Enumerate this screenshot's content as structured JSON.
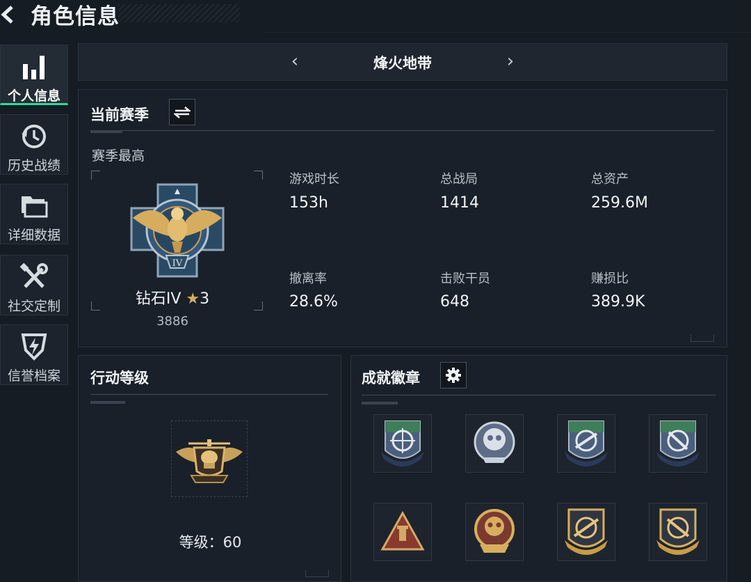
{
  "page": {
    "title": "角色信息"
  },
  "sidebar": {
    "items": [
      {
        "label": "个人信息",
        "icon": "bar-chart-icon",
        "active": true
      },
      {
        "label": "历史战绩",
        "icon": "history-clock-icon",
        "active": false
      },
      {
        "label": "详细数据",
        "icon": "folder-icon",
        "active": false
      },
      {
        "label": "社交定制",
        "icon": "tools-icon",
        "active": false
      },
      {
        "label": "信誉档案",
        "icon": "shield-icon",
        "active": false
      }
    ]
  },
  "mode_selector": {
    "current": "烽火地带",
    "prev_icon": "chevron-left-icon",
    "next_icon": "chevron-right-icon"
  },
  "season": {
    "title": "当前赛季",
    "best_label": "赛季最高",
    "rank_name": "钻石IV",
    "rank_stars": "3",
    "rank_score": "3886",
    "stats": [
      {
        "label": "游戏时长",
        "value": "153h"
      },
      {
        "label": "总战局",
        "value": "1414"
      },
      {
        "label": "总资产",
        "value": "259.6M"
      },
      {
        "label": "撤离率",
        "value": "28.6%"
      },
      {
        "label": "击败干员",
        "value": "648"
      },
      {
        "label": "赚损比",
        "value": "389.9K"
      }
    ]
  },
  "action_level": {
    "title": "行动等级",
    "level_label": "等级：",
    "level_value": "60"
  },
  "achievements": {
    "title": "成就徽章",
    "badges": [
      "green-crosshair-badge",
      "silver-round-badge",
      "green-crosshair-badge",
      "green-crosshair-badge",
      "bronze-triangle-badge",
      "gold-round-badge",
      "gold-crosshair-badge",
      "gold-crosshair-badge"
    ]
  },
  "colors": {
    "accent": "#37d59a",
    "background": "#161c24",
    "panel": "#1a2029",
    "gold": "#c8a24a"
  }
}
